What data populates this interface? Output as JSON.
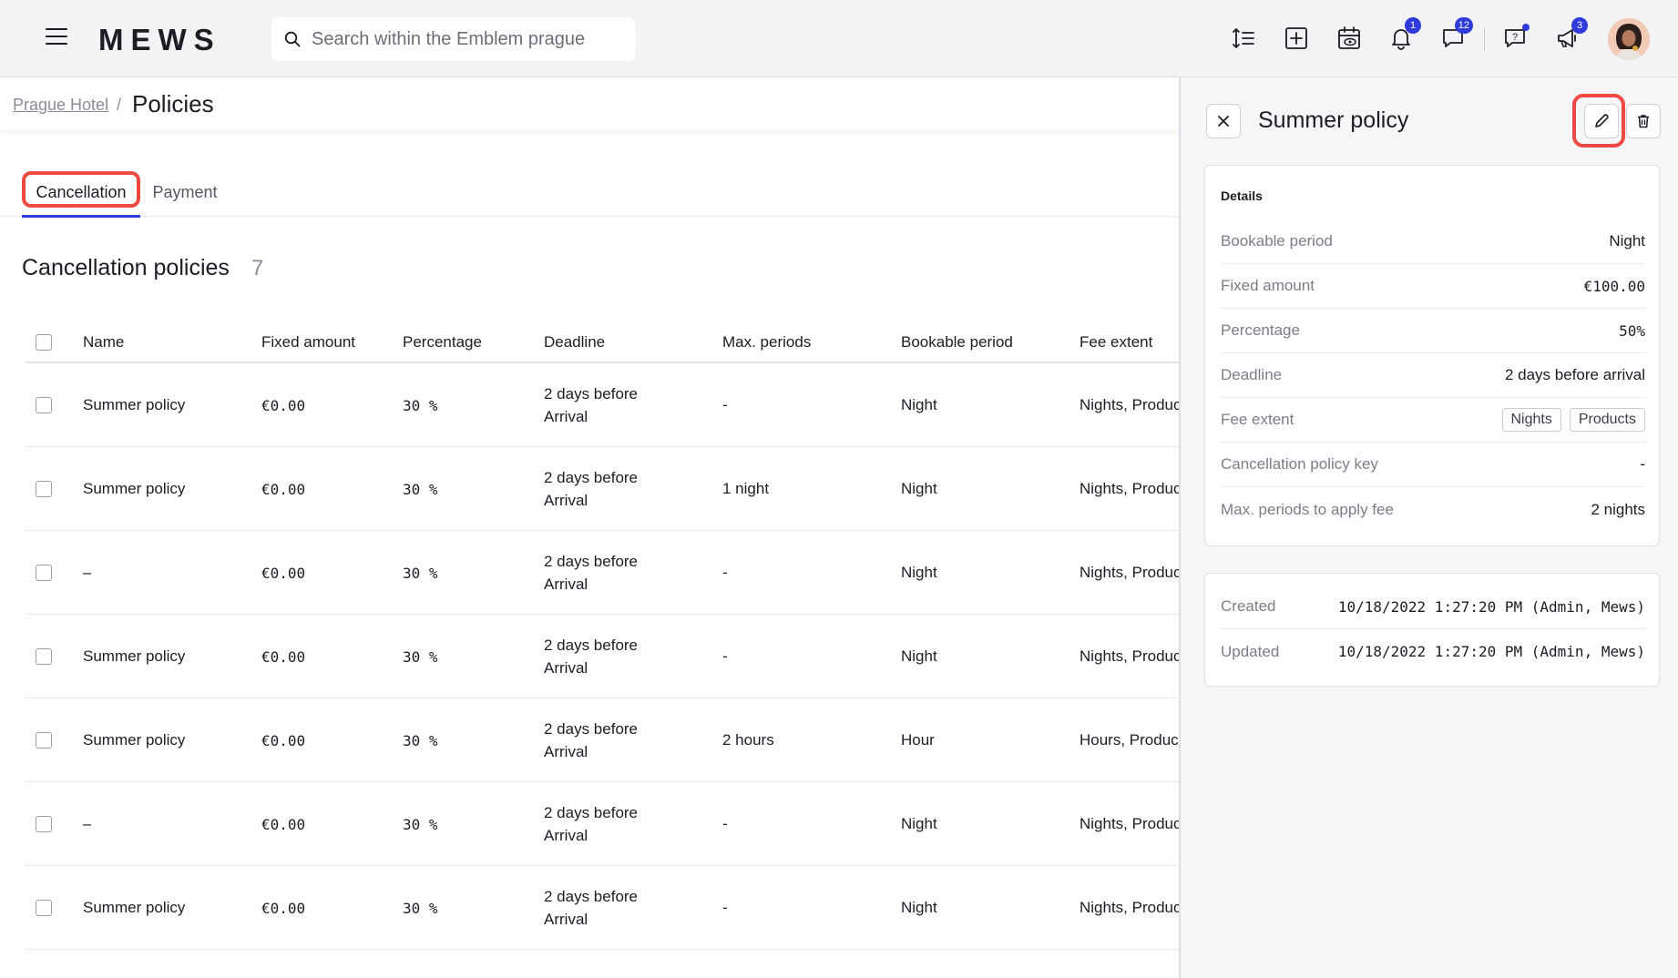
{
  "app": {
    "logo": "MEWS"
  },
  "search": {
    "placeholder": "Search within the Emblem prague"
  },
  "topbar": {
    "notifications_badge": "1",
    "messages_badge": "12",
    "announcements_badge": "3"
  },
  "breadcrumb": {
    "parent": "Prague Hotel",
    "separator": "/",
    "current": "Policies"
  },
  "tabs": {
    "cancellation": "Cancellation",
    "payment": "Payment"
  },
  "section": {
    "title": "Cancellation policies",
    "count": "7"
  },
  "table": {
    "headers": {
      "name": "Name",
      "fixed": "Fixed amount",
      "pct": "Percentage",
      "deadline": "Deadline",
      "max": "Max. periods",
      "bookable": "Bookable period",
      "fee": "Fee extent"
    },
    "rows": [
      {
        "name": "Summer policy",
        "fixed": "€0.00",
        "pct": "30 %",
        "deadline": "2 days before Arrival",
        "max": "-",
        "bookable": "Night",
        "fee": "Nights, Products"
      },
      {
        "name": "Summer policy",
        "fixed": "€0.00",
        "pct": "30 %",
        "deadline": "2 days before Arrival",
        "max": "1 night",
        "bookable": "Night",
        "fee": "Nights, Products"
      },
      {
        "name": "–",
        "fixed": "€0.00",
        "pct": "30 %",
        "deadline": "2 days before Arrival",
        "max": "-",
        "bookable": "Night",
        "fee": "Nights, Products"
      },
      {
        "name": "Summer policy",
        "fixed": "€0.00",
        "pct": "30 %",
        "deadline": "2 days before Arrival",
        "max": "-",
        "bookable": "Night",
        "fee": "Nights, Products"
      },
      {
        "name": "Summer policy",
        "fixed": "€0.00",
        "pct": "30 %",
        "deadline": "2 days before Arrival",
        "max": "2 hours",
        "bookable": "Hour",
        "fee": "Hours, Products"
      },
      {
        "name": "–",
        "fixed": "€0.00",
        "pct": "30 %",
        "deadline": "2 days before Arrival",
        "max": "-",
        "bookable": "Night",
        "fee": "Nights, Products"
      },
      {
        "name": "Summer policy",
        "fixed": "€0.00",
        "pct": "30 %",
        "deadline": "2 days before Arrival",
        "max": "-",
        "bookable": "Night",
        "fee": "Nights, Products"
      }
    ]
  },
  "panel": {
    "title": "Summer policy",
    "details_heading": "Details",
    "details": {
      "bookable_label": "Bookable period",
      "bookable_value": "Night",
      "fixed_label": "Fixed amount",
      "fixed_value": "€100.00",
      "pct_label": "Percentage",
      "pct_value": "50%",
      "deadline_label": "Deadline",
      "deadline_value": "2 days before arrival",
      "fee_label": "Fee extent",
      "fee_tag_1": "Nights",
      "fee_tag_2": "Products",
      "key_label": "Cancellation policy key",
      "key_value": "-",
      "max_label": "Max. periods to apply fee",
      "max_value": "2 nights"
    },
    "meta": {
      "created_label": "Created",
      "created_value": "10/18/2022 1:27:20 PM (Admin, Mews)",
      "updated_label": "Updated",
      "updated_value": "10/18/2022 1:27:20 PM (Admin, Mews)"
    }
  },
  "colors": {
    "accent": "#2f3cdb",
    "highlight": "#ef4a41",
    "panel_bg": "#f6f6f8"
  }
}
